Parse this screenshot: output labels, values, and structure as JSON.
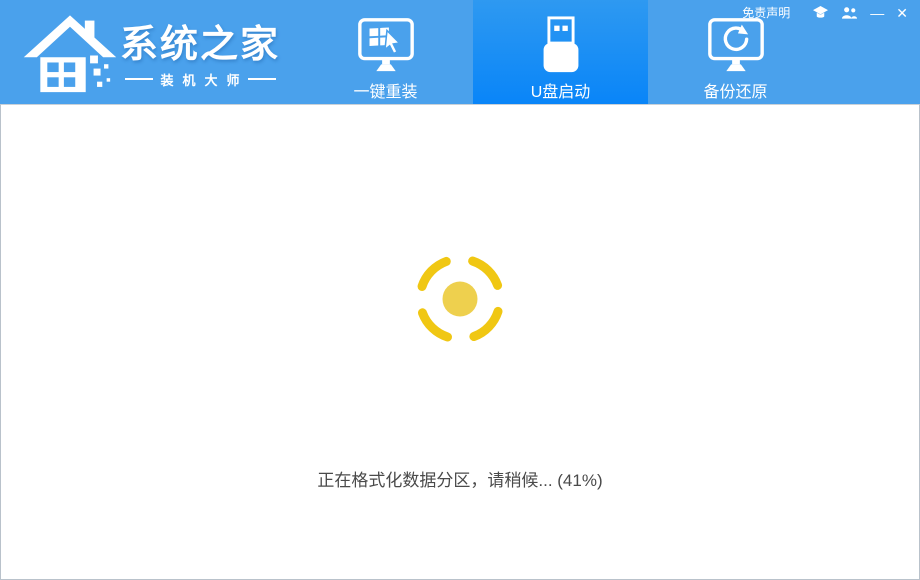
{
  "header": {
    "brand": {
      "title": "系统之家",
      "subtitle": "装机大师",
      "logo_icon": "pixel-house-icon"
    },
    "tabs": [
      {
        "label": "一键重装",
        "icon": "monitor-reinstall-icon",
        "active": false
      },
      {
        "label": "U盘启动",
        "icon": "usb-drive-icon",
        "active": true
      },
      {
        "label": "备份还原",
        "icon": "monitor-restore-icon",
        "active": false
      }
    ],
    "topbar": {
      "disclaimer": "免责声明",
      "service_icon": "graduation-cap-icon",
      "users_icon": "users-icon",
      "minimize": "—",
      "close": "✕"
    }
  },
  "main": {
    "status_text": "正在格式化数据分区，请稍候... (41%)",
    "progress_percent": 41,
    "spinner_icon": "loading-spinner-icon"
  },
  "colors": {
    "header_bg": "#4aa1ec",
    "active_tab_top": "#2e99f1",
    "active_tab_bottom": "#0985f8",
    "window_border": "#b9c2cb",
    "status_text": "#4a4a4a",
    "spinner_arc": "#f0c713",
    "spinner_core": "#eed04e"
  }
}
